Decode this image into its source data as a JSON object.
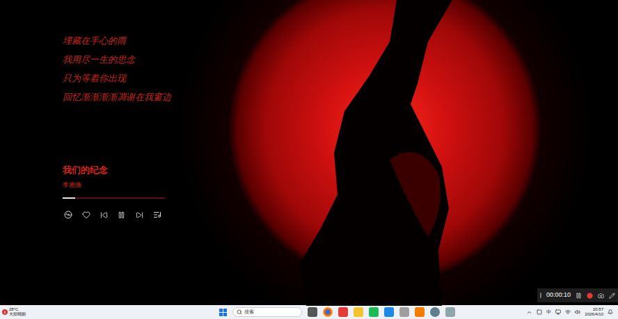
{
  "wallpaper": {
    "lyrics": [
      "埋藏在手心的雨",
      "我用尽一生的思念",
      "只为等着你出现",
      "回忆渐渐渐渐凋谢在我窗边"
    ]
  },
  "player": {
    "title": "我们的纪念",
    "artist": "李雅微",
    "progress": {
      "level": 0.12
    },
    "liked": false,
    "playing": true
  },
  "recorder": {
    "time": "00:00:10",
    "recording": true
  },
  "taskbar": {
    "weather": {
      "temperature": "28°C",
      "condition": "大部晴朗",
      "badge": "1"
    },
    "search": {
      "placeholder": "搜索"
    },
    "tray": {
      "ime": "中",
      "time": "20:57",
      "date": "2026/4/10"
    }
  }
}
